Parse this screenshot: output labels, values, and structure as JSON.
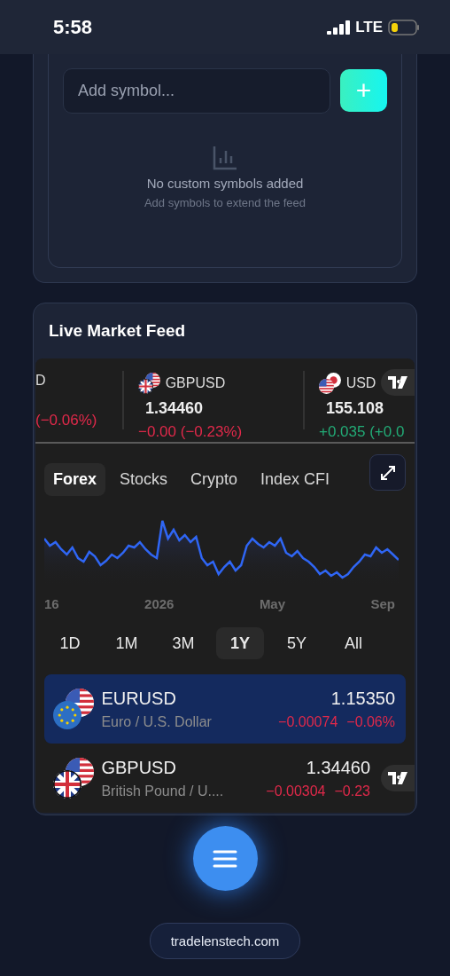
{
  "status_bar": {
    "time": "5:58",
    "network": "LTE"
  },
  "custom_symbols": {
    "placeholder": "Add symbol...",
    "add_label": "+",
    "empty_title": "No custom symbols added",
    "empty_hint": "Add symbols to extend the feed"
  },
  "feed": {
    "title": "Live Market Feed",
    "ticker": [
      {
        "symbol": "D",
        "change": "(−0.06%)",
        "positive": false
      },
      {
        "symbol": "GBPUSD",
        "price": "1.34460",
        "change": "−0.00 (−0.23%)",
        "positive": false,
        "flags": [
          {
            "kind": "us"
          },
          {
            "kind": "gb"
          }
        ]
      },
      {
        "symbol": "USD",
        "price": "155.108",
        "change": "+0.035 (+0.0",
        "positive": true,
        "flags": [
          {
            "kind": "jp"
          },
          {
            "kind": "us"
          }
        ]
      }
    ],
    "tabs": [
      {
        "label": "Forex",
        "selected": true
      },
      {
        "label": "Stocks",
        "selected": false
      },
      {
        "label": "Crypto",
        "selected": false
      },
      {
        "label": "Index CFI",
        "selected": false
      }
    ],
    "x_labels": [
      "16",
      "2026",
      "May",
      "Sep"
    ],
    "ranges": [
      {
        "label": "1D",
        "selected": false
      },
      {
        "label": "1M",
        "selected": false
      },
      {
        "label": "3M",
        "selected": false
      },
      {
        "label": "1Y",
        "selected": true
      },
      {
        "label": "5Y",
        "selected": false
      },
      {
        "label": "All",
        "selected": false
      }
    ],
    "rows": [
      {
        "symbol": "EURUSD",
        "name": "Euro / U.S. Dollar",
        "price": "1.15350",
        "change": "−0.00074",
        "percent": "−0.06%",
        "selected": true,
        "flags": [
          {
            "kind": "us"
          },
          {
            "kind": "eu"
          }
        ]
      },
      {
        "symbol": "GBPUSD",
        "name": "British Pound / U....",
        "price": "1.34460",
        "change": "−0.00304",
        "percent": "−0.23",
        "selected": false,
        "flags": [
          {
            "kind": "us"
          },
          {
            "kind": "gb"
          }
        ]
      }
    ]
  },
  "footer": {
    "link": "tradelenstech.com"
  }
}
